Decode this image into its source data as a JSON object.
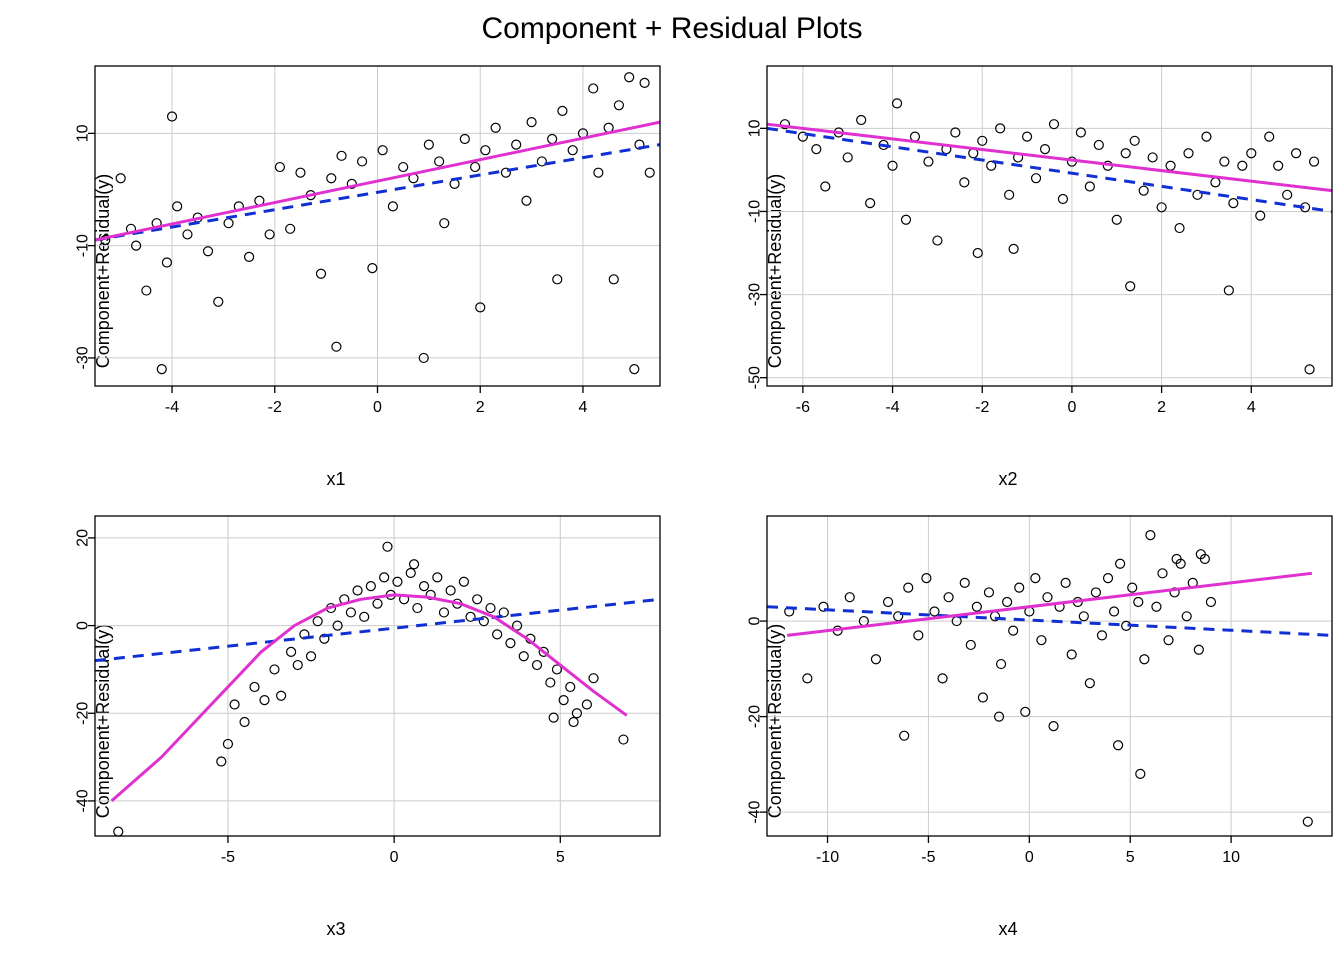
{
  "title": "Component + Residual Plots",
  "chart_data": [
    {
      "type": "scatter",
      "xlabel": "x1",
      "ylabel": "Component+Residual(y)",
      "xlim": [
        -5.5,
        5.5
      ],
      "ylim": [
        -35,
        22
      ],
      "xticks": [
        -4,
        -2,
        0,
        2,
        4
      ],
      "yticks": [
        -30,
        -10,
        10
      ],
      "linear_fit": {
        "x": [
          -5.5,
          5.5
        ],
        "y": [
          -9,
          8
        ]
      },
      "smooth_fit": {
        "x": [
          -5.5,
          5.5
        ],
        "y": [
          -9,
          12
        ]
      },
      "points": [
        [
          -5.3,
          -9
        ],
        [
          -5.0,
          2
        ],
        [
          -4.8,
          -7
        ],
        [
          -4.7,
          -10
        ],
        [
          -4.5,
          -18
        ],
        [
          -4.3,
          -6
        ],
        [
          -4.2,
          -32
        ],
        [
          -4.1,
          -13
        ],
        [
          -4.0,
          13
        ],
        [
          -3.9,
          -3
        ],
        [
          -3.7,
          -8
        ],
        [
          -3.5,
          -5
        ],
        [
          -3.3,
          -11
        ],
        [
          -3.1,
          -20
        ],
        [
          -2.9,
          -6
        ],
        [
          -2.7,
          -3
        ],
        [
          -2.5,
          -12
        ],
        [
          -2.3,
          -2
        ],
        [
          -2.1,
          -8
        ],
        [
          -1.9,
          4
        ],
        [
          -1.7,
          -7
        ],
        [
          -1.5,
          3
        ],
        [
          -1.3,
          -1
        ],
        [
          -1.1,
          -15
        ],
        [
          -0.9,
          2
        ],
        [
          -0.8,
          -28
        ],
        [
          -0.7,
          6
        ],
        [
          -0.5,
          1
        ],
        [
          -0.3,
          5
        ],
        [
          -0.1,
          -14
        ],
        [
          0.1,
          7
        ],
        [
          0.3,
          -3
        ],
        [
          0.5,
          4
        ],
        [
          0.7,
          2
        ],
        [
          0.9,
          -30
        ],
        [
          1.0,
          8
        ],
        [
          1.2,
          5
        ],
        [
          1.3,
          -6
        ],
        [
          1.5,
          1
        ],
        [
          1.7,
          9
        ],
        [
          1.9,
          4
        ],
        [
          2.0,
          -21
        ],
        [
          2.1,
          7
        ],
        [
          2.3,
          11
        ],
        [
          2.5,
          3
        ],
        [
          2.7,
          8
        ],
        [
          2.9,
          -2
        ],
        [
          3.0,
          12
        ],
        [
          3.2,
          5
        ],
        [
          3.4,
          9
        ],
        [
          3.5,
          -16
        ],
        [
          3.6,
          14
        ],
        [
          3.8,
          7
        ],
        [
          4.0,
          10
        ],
        [
          4.2,
          18
        ],
        [
          4.3,
          3
        ],
        [
          4.5,
          11
        ],
        [
          4.6,
          -16
        ],
        [
          4.7,
          15
        ],
        [
          4.9,
          20
        ],
        [
          5.0,
          -32
        ],
        [
          5.1,
          8
        ],
        [
          5.2,
          19
        ],
        [
          5.3,
          3
        ]
      ]
    },
    {
      "type": "scatter",
      "xlabel": "x2",
      "ylabel": "Component+Residual(y)",
      "xlim": [
        -6.8,
        5.8
      ],
      "ylim": [
        -52,
        25
      ],
      "xticks": [
        -6,
        -4,
        -2,
        0,
        2,
        4
      ],
      "yticks": [
        -50,
        -30,
        -10,
        10
      ],
      "linear_fit": {
        "x": [
          -6.8,
          5.8
        ],
        "y": [
          10,
          -10
        ]
      },
      "smooth_fit": {
        "x": [
          -6.8,
          5.8
        ],
        "y": [
          11,
          -5
        ]
      },
      "points": [
        [
          -6.4,
          11
        ],
        [
          -6.0,
          8
        ],
        [
          -5.7,
          5
        ],
        [
          -5.5,
          -4
        ],
        [
          -5.2,
          9
        ],
        [
          -5.0,
          3
        ],
        [
          -4.7,
          12
        ],
        [
          -4.5,
          -8
        ],
        [
          -4.2,
          6
        ],
        [
          -4.0,
          1
        ],
        [
          -3.9,
          16
        ],
        [
          -3.7,
          -12
        ],
        [
          -3.5,
          8
        ],
        [
          -3.2,
          2
        ],
        [
          -3.0,
          -17
        ],
        [
          -2.8,
          5
        ],
        [
          -2.6,
          9
        ],
        [
          -2.4,
          -3
        ],
        [
          -2.2,
          4
        ],
        [
          -2.1,
          -20
        ],
        [
          -2.0,
          7
        ],
        [
          -1.8,
          1
        ],
        [
          -1.6,
          10
        ],
        [
          -1.4,
          -6
        ],
        [
          -1.3,
          -19
        ],
        [
          -1.2,
          3
        ],
        [
          -1.0,
          8
        ],
        [
          -0.8,
          -2
        ],
        [
          -0.6,
          5
        ],
        [
          -0.4,
          11
        ],
        [
          -0.2,
          -7
        ],
        [
          0.0,
          2
        ],
        [
          0.2,
          9
        ],
        [
          0.4,
          -4
        ],
        [
          0.6,
          6
        ],
        [
          0.8,
          1
        ],
        [
          1.0,
          -12
        ],
        [
          1.2,
          4
        ],
        [
          1.3,
          -28
        ],
        [
          1.4,
          7
        ],
        [
          1.6,
          -5
        ],
        [
          1.8,
          3
        ],
        [
          2.0,
          -9
        ],
        [
          2.2,
          1
        ],
        [
          2.4,
          -14
        ],
        [
          2.6,
          4
        ],
        [
          2.8,
          -6
        ],
        [
          3.0,
          8
        ],
        [
          3.2,
          -3
        ],
        [
          3.4,
          2
        ],
        [
          3.5,
          -29
        ],
        [
          3.6,
          -8
        ],
        [
          3.8,
          1
        ],
        [
          4.0,
          4
        ],
        [
          4.2,
          -11
        ],
        [
          4.4,
          8
        ],
        [
          4.6,
          1
        ],
        [
          4.8,
          -6
        ],
        [
          5.0,
          4
        ],
        [
          5.2,
          -9
        ],
        [
          5.3,
          -48
        ],
        [
          5.4,
          2
        ]
      ]
    },
    {
      "type": "scatter",
      "xlabel": "x3",
      "ylabel": "Component+Residual(y)",
      "xlim": [
        -9,
        8
      ],
      "ylim": [
        -48,
        25
      ],
      "xticks": [
        -5,
        0,
        5
      ],
      "yticks": [
        -40,
        -20,
        0,
        20
      ],
      "linear_fit": {
        "x": [
          -9,
          8
        ],
        "y": [
          -8,
          6
        ]
      },
      "smooth_fit_points": [
        [
          -8.5,
          -40
        ],
        [
          -7,
          -30
        ],
        [
          -6,
          -22
        ],
        [
          -5,
          -14
        ],
        [
          -4,
          -6
        ],
        [
          -3,
          0
        ],
        [
          -2,
          4
        ],
        [
          -1,
          6
        ],
        [
          0,
          7
        ],
        [
          1,
          6.5
        ],
        [
          2,
          5
        ],
        [
          3,
          2
        ],
        [
          4,
          -3
        ],
        [
          5,
          -9
        ],
        [
          6,
          -15
        ],
        [
          7,
          -20.5
        ]
      ],
      "points": [
        [
          -8.3,
          -47
        ],
        [
          -5.2,
          -31
        ],
        [
          -5.0,
          -27
        ],
        [
          -4.8,
          -18
        ],
        [
          -4.5,
          -22
        ],
        [
          -4.2,
          -14
        ],
        [
          -3.9,
          -17
        ],
        [
          -3.6,
          -10
        ],
        [
          -3.4,
          -16
        ],
        [
          -3.1,
          -6
        ],
        [
          -2.9,
          -9
        ],
        [
          -2.7,
          -2
        ],
        [
          -2.5,
          -7
        ],
        [
          -2.3,
          1
        ],
        [
          -2.1,
          -3
        ],
        [
          -1.9,
          4
        ],
        [
          -1.7,
          0
        ],
        [
          -1.5,
          6
        ],
        [
          -1.3,
          3
        ],
        [
          -1.1,
          8
        ],
        [
          -0.9,
          2
        ],
        [
          -0.7,
          9
        ],
        [
          -0.5,
          5
        ],
        [
          -0.3,
          11
        ],
        [
          -0.2,
          18
        ],
        [
          -0.1,
          7
        ],
        [
          0.1,
          10
        ],
        [
          0.3,
          6
        ],
        [
          0.5,
          12
        ],
        [
          0.6,
          14
        ],
        [
          0.7,
          4
        ],
        [
          0.9,
          9
        ],
        [
          1.1,
          7
        ],
        [
          1.3,
          11
        ],
        [
          1.5,
          3
        ],
        [
          1.7,
          8
        ],
        [
          1.9,
          5
        ],
        [
          2.1,
          10
        ],
        [
          2.3,
          2
        ],
        [
          2.5,
          6
        ],
        [
          2.7,
          1
        ],
        [
          2.9,
          4
        ],
        [
          3.1,
          -2
        ],
        [
          3.3,
          3
        ],
        [
          3.5,
          -4
        ],
        [
          3.7,
          0
        ],
        [
          3.9,
          -7
        ],
        [
          4.1,
          -3
        ],
        [
          4.3,
          -9
        ],
        [
          4.5,
          -6
        ],
        [
          4.7,
          -13
        ],
        [
          4.8,
          -21
        ],
        [
          4.9,
          -10
        ],
        [
          5.1,
          -17
        ],
        [
          5.3,
          -14
        ],
        [
          5.4,
          -22
        ],
        [
          5.5,
          -20
        ],
        [
          5.8,
          -18
        ],
        [
          6.0,
          -12
        ],
        [
          6.9,
          -26
        ]
      ]
    },
    {
      "type": "scatter",
      "xlabel": "x4",
      "ylabel": "Component+Residual(y)",
      "xlim": [
        -13,
        15
      ],
      "ylim": [
        -45,
        22
      ],
      "xticks": [
        -10,
        -5,
        0,
        5,
        10
      ],
      "yticks": [
        -40,
        -20,
        0
      ],
      "linear_fit": {
        "x": [
          -13,
          15
        ],
        "y": [
          3,
          -3
        ]
      },
      "smooth_fit": {
        "x": [
          -12,
          14
        ],
        "y": [
          -3,
          10
        ]
      },
      "points": [
        [
          -11.9,
          2
        ],
        [
          -11.0,
          -12
        ],
        [
          -10.2,
          3
        ],
        [
          -9.5,
          -2
        ],
        [
          -8.9,
          5
        ],
        [
          -8.2,
          0
        ],
        [
          -7.6,
          -8
        ],
        [
          -7.0,
          4
        ],
        [
          -6.5,
          1
        ],
        [
          -6.2,
          -24
        ],
        [
          -6.0,
          7
        ],
        [
          -5.5,
          -3
        ],
        [
          -5.1,
          9
        ],
        [
          -4.7,
          2
        ],
        [
          -4.3,
          -12
        ],
        [
          -4.0,
          5
        ],
        [
          -3.6,
          0
        ],
        [
          -3.2,
          8
        ],
        [
          -2.9,
          -5
        ],
        [
          -2.6,
          3
        ],
        [
          -2.3,
          -16
        ],
        [
          -2.0,
          6
        ],
        [
          -1.7,
          1
        ],
        [
          -1.5,
          -20
        ],
        [
          -1.4,
          -9
        ],
        [
          -1.1,
          4
        ],
        [
          -0.8,
          -2
        ],
        [
          -0.5,
          7
        ],
        [
          -0.2,
          -19
        ],
        [
          0.0,
          2
        ],
        [
          0.3,
          9
        ],
        [
          0.6,
          -4
        ],
        [
          0.9,
          5
        ],
        [
          1.2,
          -22
        ],
        [
          1.5,
          3
        ],
        [
          1.8,
          8
        ],
        [
          2.1,
          -7
        ],
        [
          2.4,
          4
        ],
        [
          2.7,
          1
        ],
        [
          3.0,
          -13
        ],
        [
          3.3,
          6
        ],
        [
          3.6,
          -3
        ],
        [
          3.9,
          9
        ],
        [
          4.2,
          2
        ],
        [
          4.4,
          -26
        ],
        [
          4.5,
          12
        ],
        [
          4.8,
          -1
        ],
        [
          5.1,
          7
        ],
        [
          5.4,
          4
        ],
        [
          5.5,
          -32
        ],
        [
          5.7,
          -8
        ],
        [
          6.0,
          18
        ],
        [
          6.3,
          3
        ],
        [
          6.6,
          10
        ],
        [
          6.9,
          -4
        ],
        [
          7.2,
          6
        ],
        [
          7.3,
          13
        ],
        [
          7.5,
          12
        ],
        [
          7.8,
          1
        ],
        [
          8.1,
          8
        ],
        [
          8.4,
          -6
        ],
        [
          8.5,
          14
        ],
        [
          8.7,
          13
        ],
        [
          9.0,
          4
        ],
        [
          13.8,
          -42
        ]
      ]
    }
  ]
}
